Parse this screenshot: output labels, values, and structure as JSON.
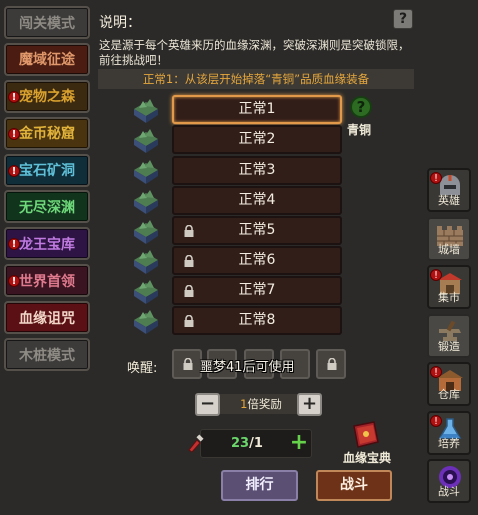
{
  "modes": [
    {
      "label": "闯关模式",
      "bg": "#3c3b3a",
      "color": "#8e8a84",
      "alert": false
    },
    {
      "label": "魔域征途",
      "bg": "#4a1c12",
      "color": "#e0986a",
      "alert": false
    },
    {
      "label": "宠物之森",
      "bg": "#3c2a10",
      "color": "#d9a12e",
      "alert": true
    },
    {
      "label": "金币秘窟",
      "bg": "#4a3410",
      "color": "#e1b23a",
      "alert": true
    },
    {
      "label": "宝石矿洞",
      "bg": "#0f2e3a",
      "color": "#5fc0d8",
      "alert": true
    },
    {
      "label": "无尽深渊",
      "bg": "#11351c",
      "color": "#6ed87a",
      "alert": false
    },
    {
      "label": "龙王宝库",
      "bg": "#2e1444",
      "color": "#c07ae0",
      "alert": true
    },
    {
      "label": "世界首领",
      "bg": "#3a1420",
      "color": "#e07a8e",
      "alert": true
    },
    {
      "label": "血缘诅咒",
      "bg": "#5a1014",
      "color": "#f2d6c8",
      "alert": false
    },
    {
      "label": "木桩模式",
      "bg": "#3c3b3a",
      "color": "#8e8a84",
      "alert": false
    }
  ],
  "header": {
    "title": "说明：",
    "help": "?",
    "description": "这是源于每个英雄来历的血缘深渊，突破深渊则是突破锁限，前往挑战吧！",
    "info": "正常1：从该层开始掉落“青铜”品质血缘装备"
  },
  "stages": [
    {
      "label": "正常1",
      "locked": false,
      "selected": true
    },
    {
      "label": "正常2",
      "locked": false,
      "selected": false
    },
    {
      "label": "正常3",
      "locked": false,
      "selected": false
    },
    {
      "label": "正常4",
      "locked": false,
      "selected": false
    },
    {
      "label": "正常5",
      "locked": true,
      "selected": false
    },
    {
      "label": "正常6",
      "locked": true,
      "selected": false
    },
    {
      "label": "正常7",
      "locked": true,
      "selected": false
    },
    {
      "label": "正常8",
      "locked": true,
      "selected": false
    }
  ],
  "reward": {
    "icon": "?",
    "label": "青铜"
  },
  "awaken": {
    "label": "唤醒:",
    "note": "噩梦41后可使用"
  },
  "multiplier": {
    "minus": "−",
    "plus": "+",
    "value": "1",
    "suffix": "倍奖励"
  },
  "stamina": {
    "current": "23",
    "max": "/1",
    "plus": "+"
  },
  "book": {
    "label": "血缘宝典"
  },
  "buttons": {
    "rank": "排行",
    "fight": "战斗"
  },
  "side_nav": [
    {
      "label": "英雄",
      "icon": "helmet-icon",
      "alert": true,
      "active": true
    },
    {
      "label": "城墙",
      "icon": "wall-icon",
      "alert": false,
      "active": false
    },
    {
      "label": "集市",
      "icon": "market-icon",
      "alert": true,
      "active": true
    },
    {
      "label": "锻造",
      "icon": "anvil-icon",
      "alert": false,
      "active": false
    },
    {
      "label": "仓库",
      "icon": "warehouse-icon",
      "alert": true,
      "active": true
    },
    {
      "label": "培养",
      "icon": "flask-icon",
      "alert": true,
      "active": true
    },
    {
      "label": "战斗",
      "icon": "portal-icon",
      "alert": false,
      "active": true
    }
  ],
  "colors": {
    "accent": "#e29a4a",
    "info": "#e5a83a",
    "stage_bg": "#321e19"
  }
}
